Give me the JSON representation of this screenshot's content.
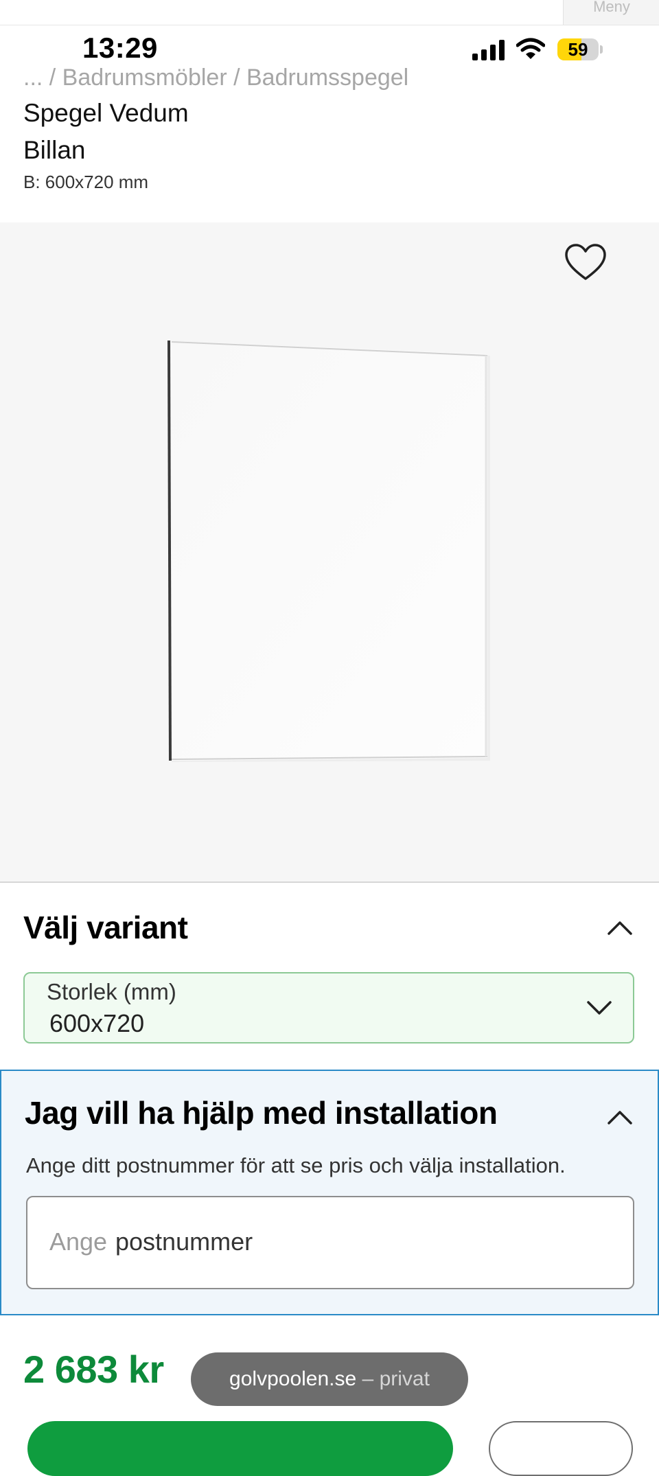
{
  "status_bar": {
    "time": "13:29",
    "battery_percent": "59",
    "battery_level": 0.59,
    "icons": [
      "signal-icon",
      "wifi-icon",
      "battery-icon"
    ]
  },
  "nav": {
    "menu_label": "Meny"
  },
  "breadcrumb": "... / Badrumsmöbler / Badrumsspegel",
  "product": {
    "title_line1": "Spegel Vedum",
    "title_line2": "Billan",
    "spec": "B: 600x720 mm"
  },
  "variant": {
    "heading": "Välj variant",
    "size_label": "Storlek (mm)",
    "size_value": "600x720"
  },
  "installation": {
    "heading": "Jag vill ha hjälp med installation",
    "description": "Ange ditt postnummer för att se pris och välja installation.",
    "placeholder": "Ange",
    "value": "postnummer"
  },
  "price": "2 683 kr",
  "site": {
    "domain": "golvpoolen.se",
    "separator": "–",
    "mode": "privat"
  },
  "colors": {
    "price_green": "#0d8a3a",
    "select_border": "#8cc995",
    "install_border": "#2a8ac7",
    "battery_yellow": "#ffd60a"
  }
}
